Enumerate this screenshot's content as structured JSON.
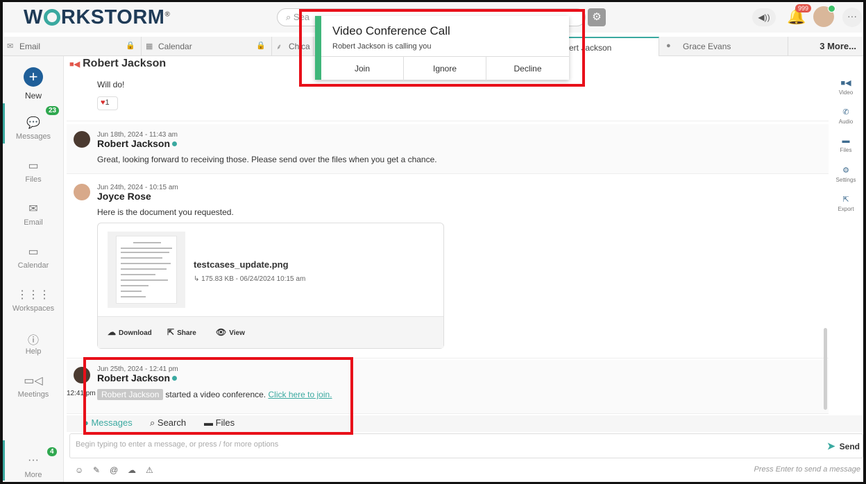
{
  "app": {
    "logo": "WORKSTORM",
    "logo_left": "W",
    "logo_right": "RKSTORM",
    "trademark": "®",
    "search_placeholder": "Sea",
    "notification_count": "999",
    "more_dots": "···"
  },
  "tabs": {
    "items": [
      {
        "icon": "email-icon",
        "label": "Email"
      },
      {
        "icon": "calendar-icon",
        "label": "Calendar"
      },
      {
        "icon": "workspace-icon",
        "label": "Chica"
      },
      {
        "icon": "person-icon",
        "label": "ert Jackson"
      },
      {
        "icon": "person-icon",
        "label": "Grace Evans"
      }
    ],
    "more": "3 More..."
  },
  "nav": {
    "new": "New",
    "messages": "Messages",
    "messages_badge": "23",
    "files": "Files",
    "email": "Email",
    "calendar": "Calendar",
    "workspaces": "Workspaces",
    "help": "Help",
    "meetings": "Meetings",
    "more": "More",
    "more_badge": "4",
    "more_dots": "···"
  },
  "conversation": {
    "title": "Robert Jackson",
    "messages": [
      {
        "text": "Will do!",
        "reaction_count": "1"
      },
      {
        "date": "Jun 18th, 2024 - 11:43 am",
        "author": "Robert Jackson",
        "text": "Great, looking forward to receiving those. Please send over the files when you get a chance."
      },
      {
        "date": "Jun 24th, 2024 - 10:15 am",
        "author": "Joyce Rose",
        "text": "Here is the document you requested."
      },
      {
        "date": "Jun 25th, 2024 - 12:41 pm",
        "author": "Robert Jackson",
        "time": "12:41 pm",
        "pill": "Robert Jackson",
        "text": "started a video conference.",
        "link": "Click here to join."
      }
    ],
    "attachment": {
      "filename": "testcases_update.png",
      "meta": "↳ 175.83 KB - 06/24/2024 10:15 am",
      "download": "Download",
      "share": "Share",
      "view": "View"
    }
  },
  "right_tools": {
    "video": "Video",
    "audio": "Audio",
    "files": "Files",
    "settings": "Settings",
    "export": "Export"
  },
  "subtabs": {
    "messages": "Messages",
    "search": "Search",
    "files": "Files"
  },
  "composer": {
    "placeholder": "Begin typing to enter a message, or press / for more options",
    "send": "Send",
    "hint": "Press Enter to send a message"
  },
  "call_popup": {
    "title": "Video Conference Call",
    "subtitle": "Robert Jackson is calling you",
    "join": "Join",
    "ignore": "Ignore",
    "decline": "Decline"
  },
  "colors": {
    "accent": "#3aa9a0",
    "highlight_box": "#e8101a",
    "call_bar": "#3fb67a"
  }
}
